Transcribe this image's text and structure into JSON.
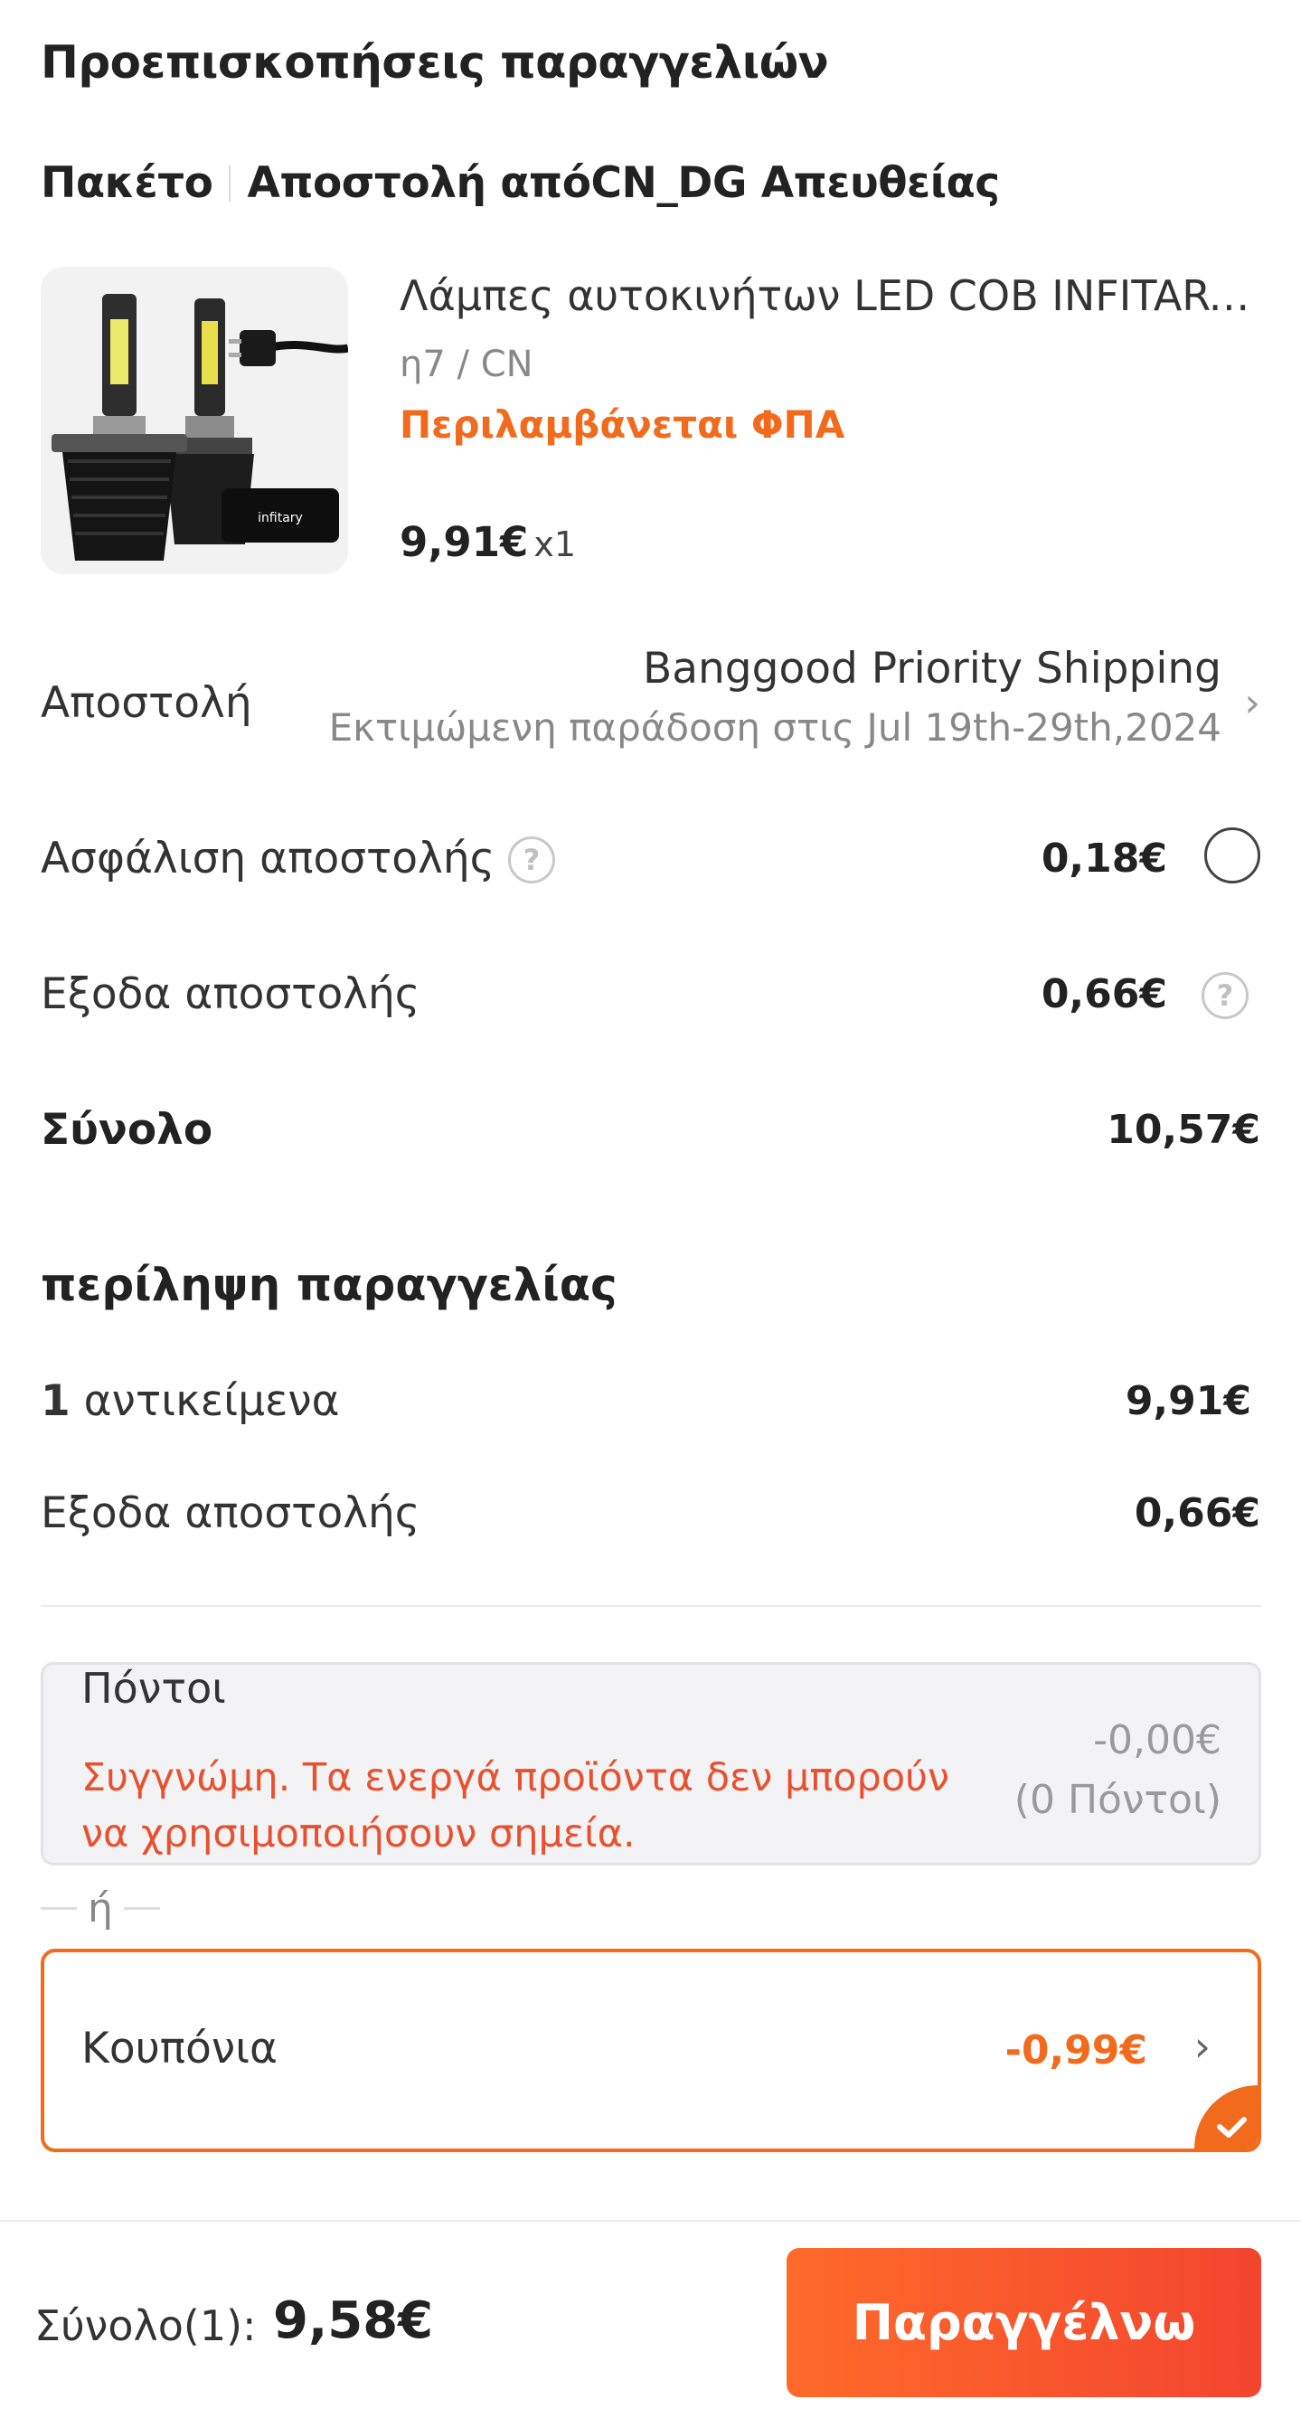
{
  "header": {
    "title": "Προεπισκοπήσεις παραγγελιών"
  },
  "package": {
    "label": "Πακέτο",
    "ship_from": "Αποστολή απόCN_DG Απευθείας"
  },
  "product": {
    "name": "Λάμπες αυτοκινήτων LED COB INFITARY...",
    "variant": "η7 / CN",
    "vat_note": "Περιλαμβάνεται ΦΠΑ",
    "price": "9,91€",
    "quantity": "x1",
    "image_brand_text": "infitary"
  },
  "shipping": {
    "label": "Αποστολή",
    "method": "Banggood Priority Shipping",
    "estimate": "Εκτιμώμενη παράδοση στις Jul 19th-29th,2024"
  },
  "insurance": {
    "label": "Ασφάλιση αποστολής",
    "value": "0,18€",
    "selected": false
  },
  "shipping_cost": {
    "label": "Εξοδα αποστολής",
    "value": "0,66€"
  },
  "subtotal": {
    "label": "Σύνολο",
    "value": "10,57€"
  },
  "summary": {
    "title": "περίληψη παραγγελίας",
    "items_count": "1",
    "items_label": "αντικείμενα",
    "items_value": "9,91€",
    "shipping_label": "Εξοδα αποστολής",
    "shipping_value": "0,66€"
  },
  "points": {
    "title": "Πόντοι",
    "error": "Συγγνώμη. Τα ενεργά προϊόντα δεν μπορούν να χρησιμοποιήσουν σημεία.",
    "amount": "-0,00€",
    "count": "(0 Πόντοι)"
  },
  "or_label": "ή",
  "coupons": {
    "label": "Κουπόνια",
    "value": "-0,99€",
    "selected": true
  },
  "footer": {
    "total_label": "Σύνολο(1):",
    "total_value": "9,58€",
    "order_button": "Παραγγέλνω"
  },
  "colors": {
    "accent": "#f26b1d",
    "error": "#e8512f",
    "button_start": "#ff6a2a",
    "button_end": "#f2452f"
  },
  "icons": {
    "help": "question-circle-icon",
    "chevron": "chevron-right-icon",
    "check": "check-icon"
  }
}
